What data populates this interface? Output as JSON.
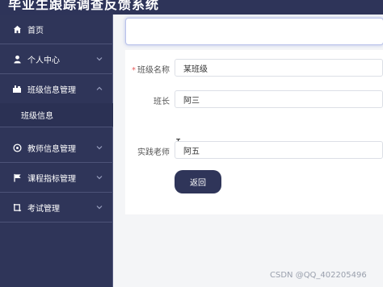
{
  "app": {
    "title": "毕业生跟踪调查反馈系统"
  },
  "sidebar": {
    "items": [
      {
        "label": "首页",
        "icon": "home-icon"
      },
      {
        "label": "个人中心",
        "icon": "user-icon"
      },
      {
        "label": "班级信息管理",
        "icon": "class-icon"
      },
      {
        "label": "教师信息管理",
        "icon": "teacher-icon"
      },
      {
        "label": "课程指标管理",
        "icon": "flag-icon"
      },
      {
        "label": "考试管理",
        "icon": "exam-icon"
      }
    ],
    "submenu": {
      "label": "班级信息"
    }
  },
  "form": {
    "fields": [
      {
        "label": "班级名称",
        "value": "某班级",
        "required": true
      },
      {
        "label": "班长",
        "value": "阿三",
        "required": false
      },
      {
        "label": "实践老师",
        "value": "阿五",
        "required": false
      }
    ],
    "back_button": "返回"
  },
  "watermark": "CSDN @QQ_402205496",
  "colors": {
    "sidebar_bg": "#2f3559",
    "button_bg": "#2f3559",
    "required_star": "#e85a5a"
  }
}
